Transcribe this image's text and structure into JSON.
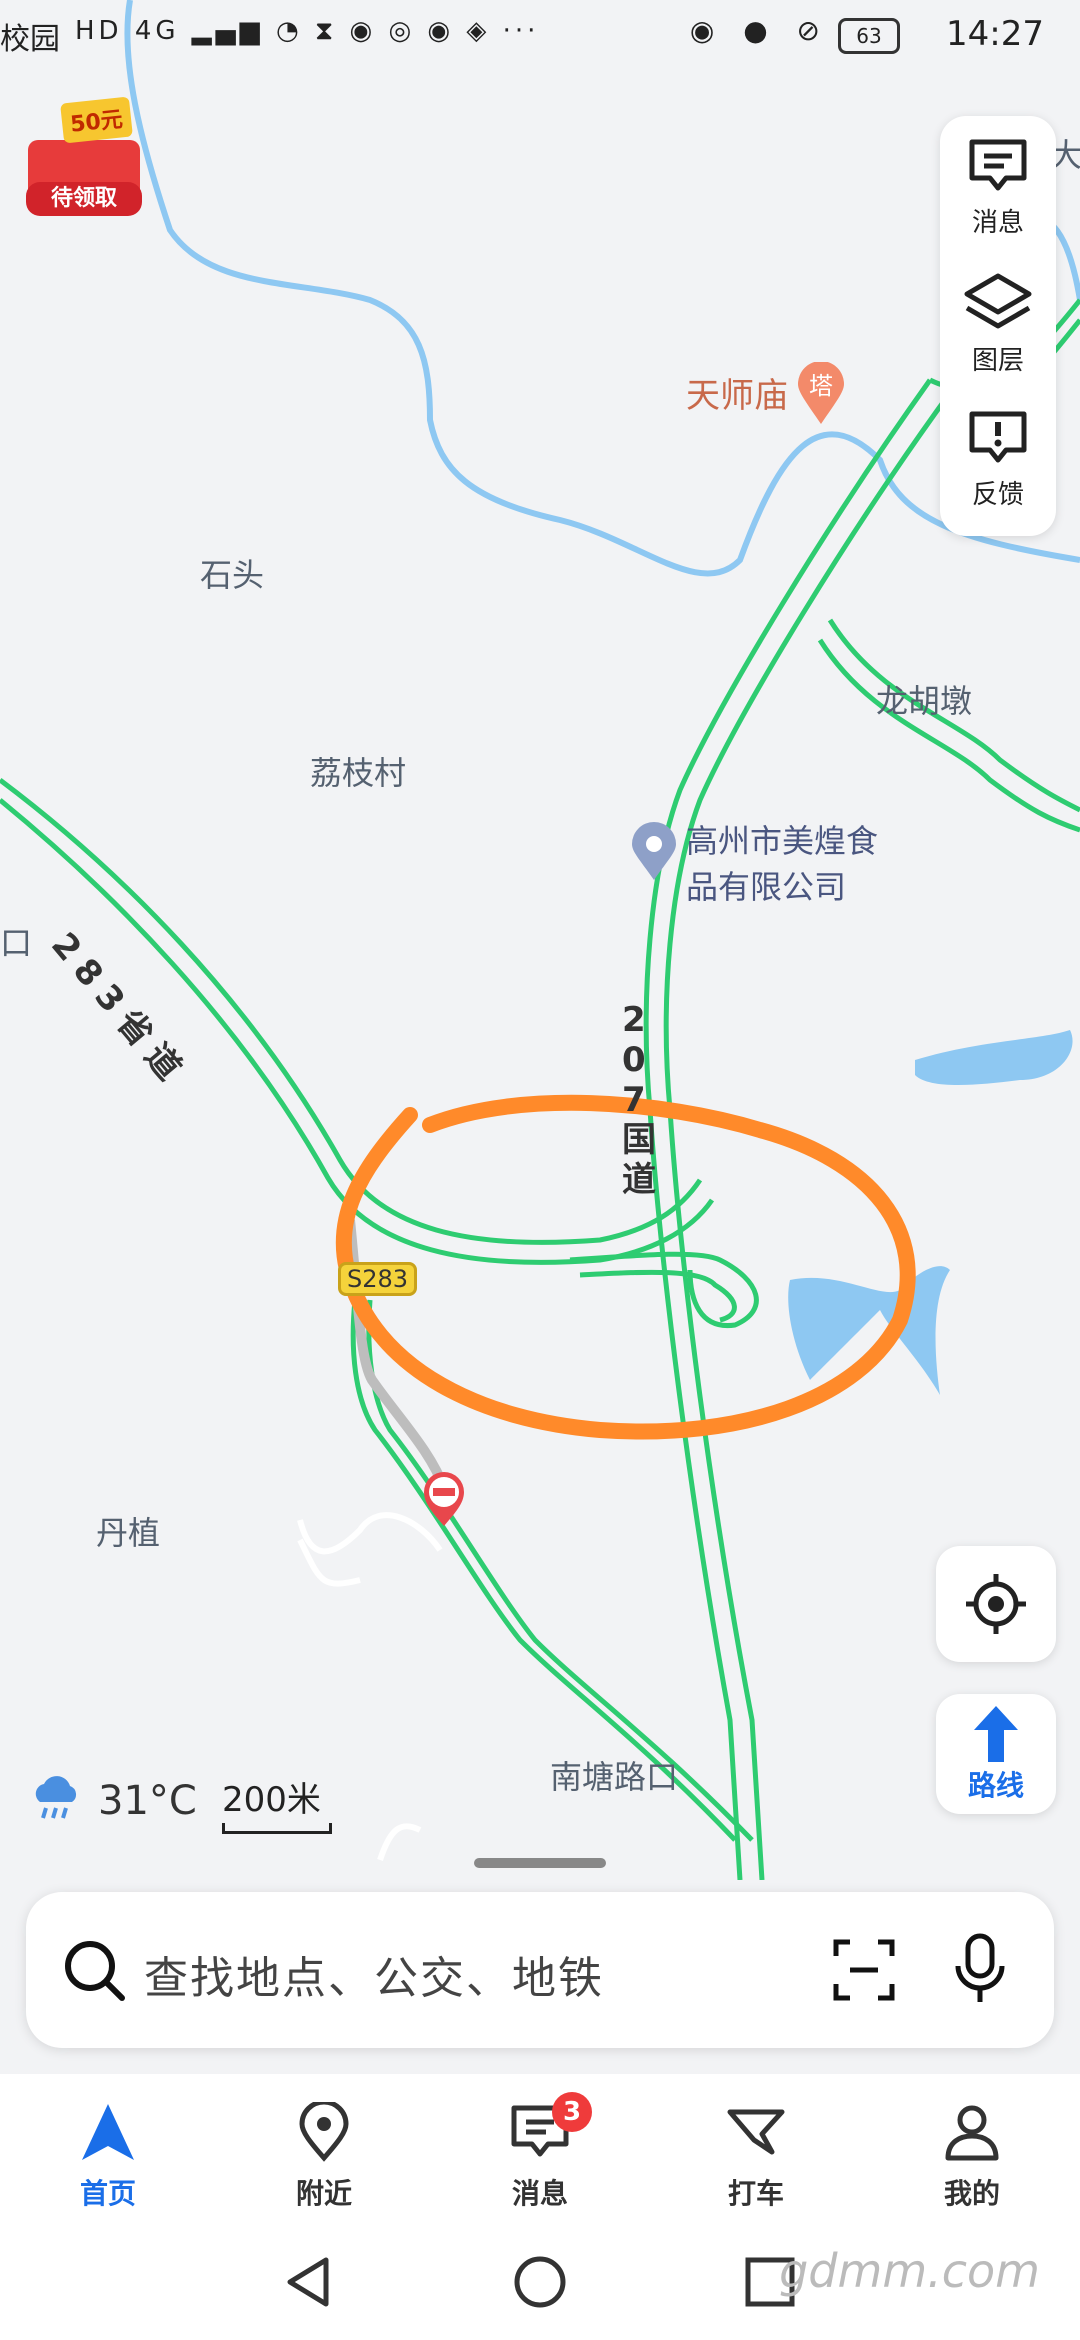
{
  "status_bar": {
    "left_text": "校园",
    "signal": "HD 4G",
    "battery": "63",
    "time": "14:27",
    "more": "···"
  },
  "promo": {
    "amount": "50元",
    "label": "待领取"
  },
  "tools": [
    {
      "label": "消息",
      "icon": "message-icon"
    },
    {
      "label": "图层",
      "icon": "layers-icon"
    },
    {
      "label": "反馈",
      "icon": "feedback-icon"
    }
  ],
  "map": {
    "labels": {
      "tianshimiao": "天师庙",
      "shitou": "石头",
      "lizhicun": "荔枝村",
      "longhudun": "龙胡墩",
      "company_line1": "高州市美煌食",
      "company_line2": "品有限公司",
      "danzhi": "丹植",
      "nantanglukou": "南塘路口",
      "edge_left": "口",
      "edge_right": "大"
    },
    "roads": {
      "provincial": "283省道",
      "national": "207国道",
      "shield": "S283"
    }
  },
  "route_button": {
    "label": "路线"
  },
  "weather": {
    "temp": "31°C",
    "icon": "rain-cloud-icon"
  },
  "scale": {
    "label": "200米"
  },
  "search": {
    "placeholder": "查找地点、公交、地铁"
  },
  "bottom_nav": {
    "items": [
      {
        "label": "首页",
        "icon": "navigation-arrow-icon",
        "active": true
      },
      {
        "label": "附近",
        "icon": "location-pin-icon"
      },
      {
        "label": "消息",
        "icon": "message-icon",
        "badge": "3"
      },
      {
        "label": "打车",
        "icon": "taxi-flag-icon"
      },
      {
        "label": "我的",
        "icon": "person-icon"
      }
    ]
  },
  "watermark": "gdmm.com",
  "colors": {
    "accent": "#1a6ee8",
    "road": "#2ecc71",
    "river": "#8ec8f2",
    "annotation": "#ff8a2a",
    "badge": "#ef3b3b"
  }
}
